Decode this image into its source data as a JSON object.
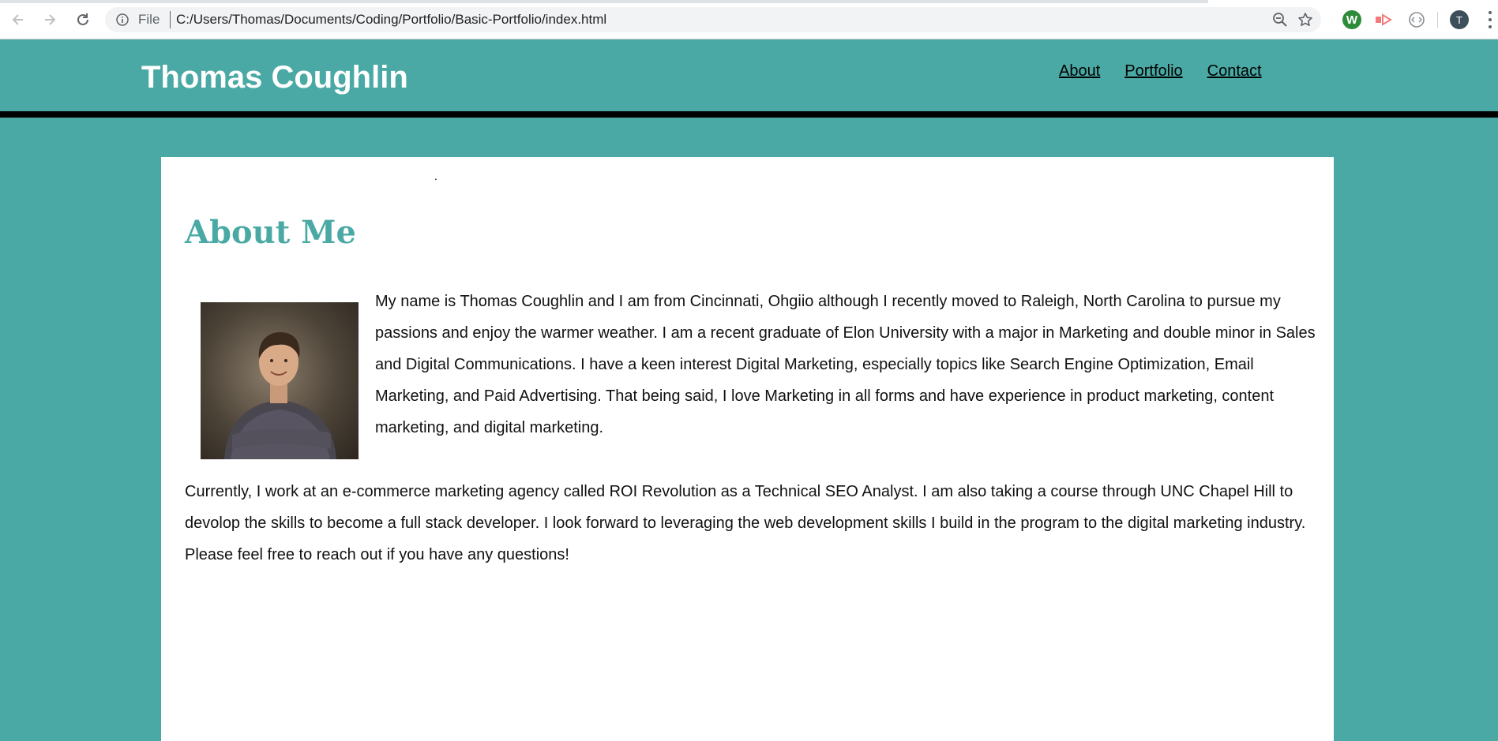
{
  "browser": {
    "url_scheme_label": "File",
    "url": "C:/Users/Thomas/Documents/Coding/Portfolio/Basic-Portfolio/index.html",
    "extension_w_label": "W",
    "profile_initial": "T",
    "icons": [
      "back-arrow-icon",
      "forward-arrow-icon",
      "reload-icon",
      "info-icon",
      "zoom-out-icon",
      "star-icon",
      "extension-w-icon",
      "extension-arrow-icon",
      "extension-code-icon",
      "profile-avatar",
      "more-menu-icon"
    ]
  },
  "header": {
    "title": "Thomas Coughlin",
    "nav": [
      "About",
      "Portfolio",
      "Contact"
    ]
  },
  "main": {
    "stray_text": ".",
    "section_title": "About Me",
    "paragraph1": "My name is Thomas Coughlin and I am from Cincinnati, Ohgiio although I recently moved to Raleigh, North Carolina to pursue my passions and enjoy the warmer weather. I am a recent graduate of Elon University with a major in Marketing and double minor in Sales and Digital Communications. I have a keen interest Digital Marketing, especially topics like Search Engine Optimization, Email Marketing, and Paid Advertising. That being said, I love Marketing in all forms and have experience in product marketing, content marketing, and digital marketing.",
    "paragraph2": "Currently, I work at an e-commerce marketing agency called ROI Revolution as a Technical SEO Analyst. I am also taking a course through UNC Chapel Hill to devolop the skills to become a full stack developer. I look forward to leveraging the web development skills I build in the program to the digital marketing industry. Please feel free to reach out if you have any questions!"
  },
  "colors": {
    "brand_teal": "#4aa9a4",
    "header_rule": "#000000",
    "card_bg": "#ffffff"
  }
}
